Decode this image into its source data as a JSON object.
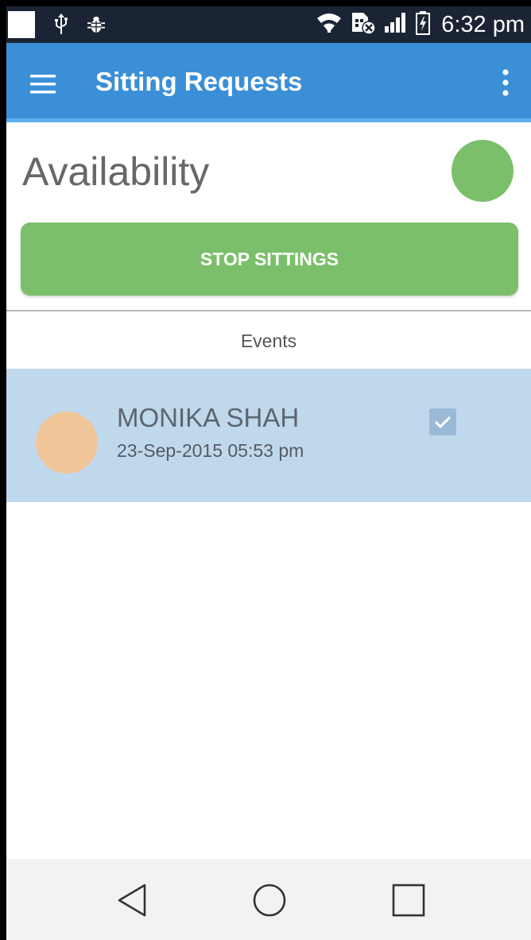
{
  "status_bar": {
    "time": "6:32 pm",
    "icons": [
      "notification-square",
      "usb-icon",
      "debug-bug-icon",
      "wifi-icon",
      "sim-error-icon",
      "signal-icon",
      "battery-charging-icon"
    ]
  },
  "app_bar": {
    "title": "Sitting Requests",
    "menu_icon": "hamburger-menu-icon",
    "overflow_icon": "more-vert-icon",
    "color": "#3a8fd6"
  },
  "availability": {
    "title": "Availability",
    "status_color": "#7bbf6a"
  },
  "stop_button": {
    "label": "STOP SITTINGS",
    "color": "#7bbf6a"
  },
  "events": {
    "label": "Events",
    "items": [
      {
        "name": "MONIKA SHAH",
        "datetime": "23-Sep-2015 05:53 pm",
        "checked": true,
        "avatar_color": "#f0c698",
        "row_color": "#c0d8ec"
      }
    ]
  },
  "nav_bar": {
    "icons": [
      "back-icon",
      "home-icon",
      "recents-icon"
    ]
  }
}
